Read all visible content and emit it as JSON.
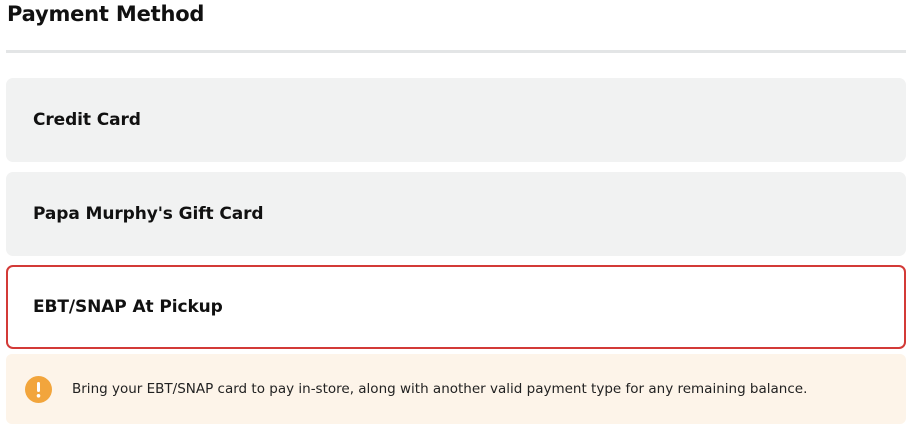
{
  "payment_method": {
    "title": "Payment Method",
    "options": [
      {
        "label": "Credit Card",
        "selected": false
      },
      {
        "label": "Papa Murphy's Gift Card",
        "selected": false
      },
      {
        "label": "EBT/SNAP At Pickup",
        "selected": true
      }
    ],
    "notice": {
      "icon": "warning-icon",
      "text": "Bring your EBT/SNAP card to pay in-store, along with another valid payment type for any remaining balance."
    }
  },
  "colors": {
    "selected_border": "#d33a37",
    "option_background": "#f1f2f2",
    "notice_background": "#fdf4e9",
    "notice_icon": "#f2a53c"
  }
}
